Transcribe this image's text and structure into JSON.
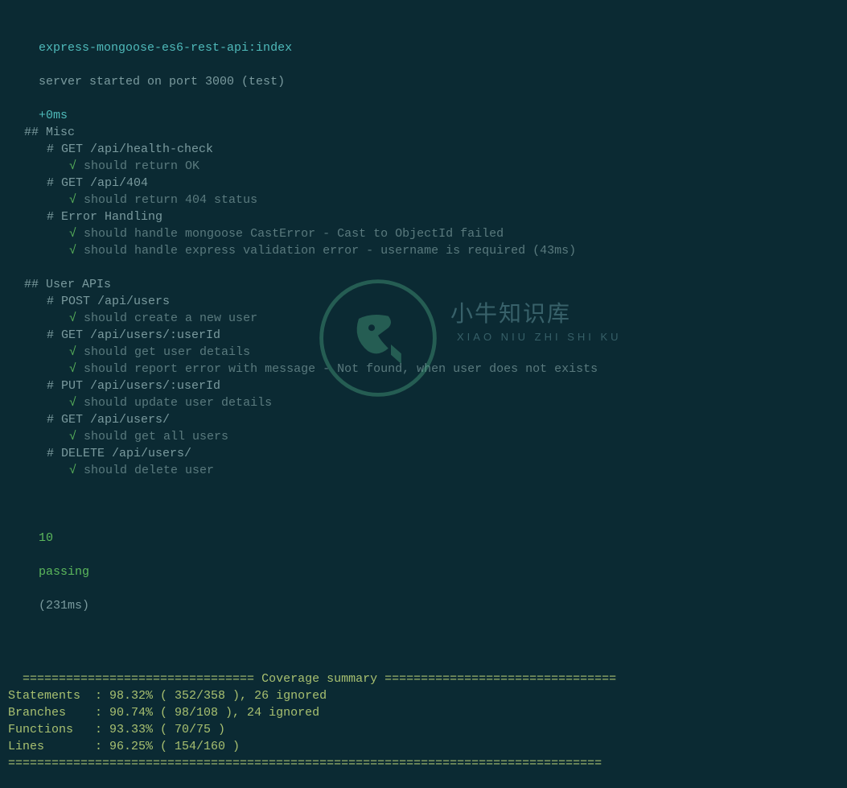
{
  "server_line": {
    "namespace": "express-mongoose-es6-rest-api:index",
    "message": "server started on port 3000 (test)",
    "timing": "+0ms"
  },
  "suites": [
    {
      "title": "## Misc",
      "groups": [
        {
          "title": "# GET /api/health-check",
          "tests": [
            {
              "text": "should return OK",
              "timing": ""
            }
          ]
        },
        {
          "title": "# GET /api/404",
          "tests": [
            {
              "text": "should return 404 status",
              "timing": ""
            }
          ]
        },
        {
          "title": "# Error Handling",
          "tests": [
            {
              "text": "should handle mongoose CastError - Cast to ObjectId failed",
              "timing": ""
            },
            {
              "text": "should handle express validation error - username is required",
              "timing": "(43ms)"
            }
          ]
        }
      ]
    },
    {
      "title": "## User APIs",
      "groups": [
        {
          "title": "# POST /api/users",
          "tests": [
            {
              "text": "should create a new user",
              "timing": ""
            }
          ]
        },
        {
          "title": "# GET /api/users/:userId",
          "tests": [
            {
              "text": "should get user details",
              "timing": ""
            },
            {
              "text": "should report error with message - Not found, when user does not exists",
              "timing": ""
            }
          ]
        },
        {
          "title": "# PUT /api/users/:userId",
          "tests": [
            {
              "text": "should update user details",
              "timing": ""
            }
          ]
        },
        {
          "title": "# GET /api/users/",
          "tests": [
            {
              "text": "should get all users",
              "timing": ""
            }
          ]
        },
        {
          "title": "# DELETE /api/users/",
          "tests": [
            {
              "text": "should delete user",
              "timing": ""
            }
          ]
        }
      ]
    }
  ],
  "summary": {
    "passing_count": "10",
    "passing_label": "passing",
    "duration": "(231ms)"
  },
  "coverage": {
    "header_left": "================================",
    "header_title": " Coverage summary ",
    "header_right": "================================",
    "rows": [
      {
        "label": "Statements  ",
        "value": ": 98.32% ( 352/358 ), 26 ignored"
      },
      {
        "label": "Branches    ",
        "value": ": 90.74% ( 98/108 ), 24 ignored"
      },
      {
        "label": "Functions   ",
        "value": ": 93.33% ( 70/75 )"
      },
      {
        "label": "Lines       ",
        "value": ": 96.25% ( 154/160 )"
      }
    ],
    "footer": "=================================================================================="
  },
  "watermark": {
    "main": "小牛知识库",
    "sub": "XIAO NIU ZHI SHI KU"
  },
  "check_symbol": "√"
}
